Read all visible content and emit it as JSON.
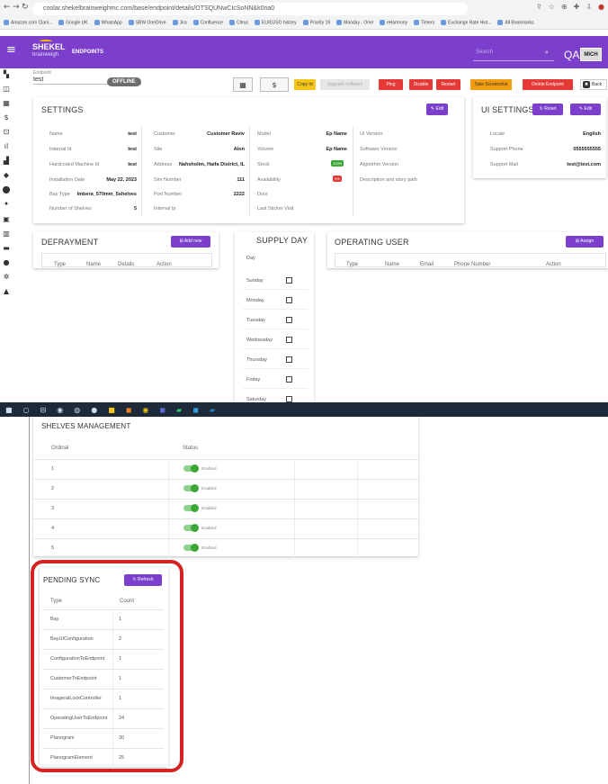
{
  "browser": {
    "url": "coolar.shekelbrainweighmc.com/base/endpoint/details/OTSQUNwCIcSoNN&k0na0",
    "bookmarks": [
      "Amazon.com Clani...",
      "Google UK",
      "WhatsApp",
      "SBW OneDrive",
      "Jira",
      "Confluence",
      "Citrus",
      "EU/EUSO history",
      "Priority 19",
      "Monday - Oriel",
      "eHarmony",
      "Timers",
      "Exchange Rate Hist...",
      "All Bookmarks"
    ]
  },
  "header": {
    "menu": "≡",
    "logo": "SHEKEL",
    "logo_sub": "brainweigh",
    "title": "ENDPOINTS",
    "search_placeholder": "Search",
    "env": "QA",
    "avatar": "MICH"
  },
  "toolbar": {
    "endpoint_label": "Endpoint",
    "endpoint_value": "test",
    "status": "OFFLINE",
    "copy": "Copy Id",
    "upgrade": "Upgrade software",
    "ping": "Ping",
    "disable": "Disable",
    "restart": "Restart",
    "screenshot": "Take Screenshot",
    "delete": "Delete Endpoint",
    "back": "Back",
    "grid_icon": "▦",
    "dollar_icon": "$"
  },
  "settings": {
    "title": "SETTINGS",
    "edit": "Edit",
    "col1": [
      [
        "Name",
        "test"
      ],
      [
        "Internal Id",
        "test"
      ],
      [
        "Hardcoded Machine Id",
        "test"
      ],
      [
        "Installation Date",
        "May 22, 2023"
      ],
      [
        "Bay Type",
        "Imbera_570mm_5shelves"
      ],
      [
        "Number of Shelves",
        "5"
      ]
    ],
    "col2": [
      [
        "Customer",
        "Customer Raviv"
      ],
      [
        "Site",
        "Alon"
      ],
      [
        "Address",
        "Nahsholim, Haifa District, IL"
      ],
      [
        "Sim Number",
        "111"
      ],
      [
        "Port Number",
        "2222"
      ],
      [
        "Internal Ip",
        ""
      ]
    ],
    "col3": [
      [
        "Model",
        "Ep Name"
      ],
      [
        "Volume",
        "Ep Name"
      ],
      [
        "Stock",
        ""
      ],
      [
        "Availability",
        ""
      ],
      [
        "Door",
        ""
      ],
      [
        "Last Sticker Visit",
        ""
      ]
    ],
    "col4": [
      "UI Version",
      "Software Version",
      "Algorithm Version",
      "Description and story path"
    ],
    "stock_badge": "100%",
    "avail_badge": "0%"
  },
  "ui_settings": {
    "title": "UI SETTINGS",
    "reset": "Reset",
    "edit": "Edit",
    "rows": [
      [
        "Locale",
        "English"
      ],
      [
        "Support Phone",
        "0555555555"
      ],
      [
        "Support Mail",
        "test@test.com"
      ]
    ]
  },
  "defrayment": {
    "title": "DEFRAYMENT",
    "add": "Add new",
    "cols": [
      "Type",
      "Name",
      "Details",
      "Action"
    ]
  },
  "supply": {
    "title": "SUPPLY DAY",
    "head": "Day",
    "days": [
      "Sunday",
      "Monday",
      "Tuesday",
      "Wednesday",
      "Thursday",
      "Friday",
      "Saturday"
    ]
  },
  "operating": {
    "title": "OPERATING USER",
    "assign": "Assign",
    "cols": [
      "Type",
      "Name",
      "Email",
      "Phone Number",
      "Action"
    ]
  },
  "shelves": {
    "title": "SHELVES MANAGEMENT",
    "cols": [
      "Ordinal",
      "Status"
    ],
    "rows": [
      [
        "1",
        "Enabled"
      ],
      [
        "2",
        "Enabled"
      ],
      [
        "3",
        "Enabled"
      ],
      [
        "4",
        "Enabled"
      ],
      [
        "5",
        "Enabled"
      ]
    ]
  },
  "pending": {
    "title": "PENDING SYNC",
    "refresh": "Refresh",
    "cols": [
      "Type",
      "Count"
    ],
    "rows": [
      [
        "Bay",
        "1"
      ],
      [
        "BayUIConfiguration",
        "2"
      ],
      [
        "ConfigurationToEndpoint",
        "1"
      ],
      [
        "CustomerToEndpoint",
        "1"
      ],
      [
        "ImageralLockController",
        "1"
      ],
      [
        "OperatingUserToEndpoint",
        "24"
      ],
      [
        "Planogram",
        "30"
      ],
      [
        "PlanogramElement",
        "25"
      ]
    ]
  },
  "colors": {
    "purple": "#7b3fcb",
    "red": "#e53935",
    "yellow": "#f5c518",
    "orange": "#f39c12",
    "green": "#3aa736",
    "highlight": "#d42320"
  }
}
